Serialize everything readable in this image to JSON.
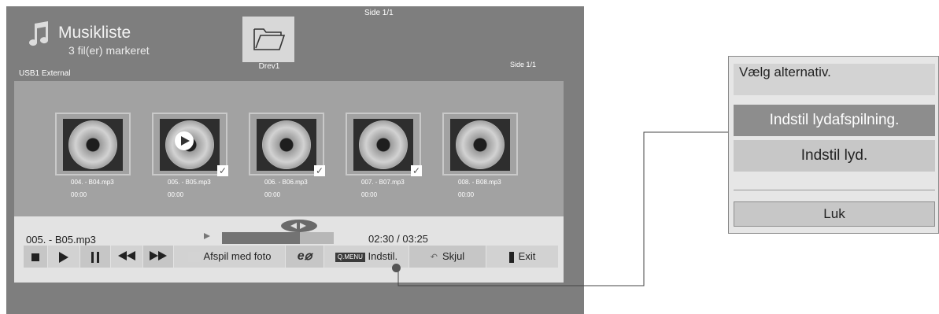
{
  "header": {
    "title": "Musikliste",
    "subtitle": "3 fil(er) markeret",
    "source": "USB1 External",
    "folder_label": "Drev1",
    "page_top": "Side 1/1",
    "page_right": "Side 1/1"
  },
  "files": [
    {
      "name": "004. - B04.mp3",
      "duration": "00:00",
      "checked": false,
      "playing": false
    },
    {
      "name": "005. - B05.mp3",
      "duration": "00:00",
      "checked": true,
      "playing": true
    },
    {
      "name": "006. - B06.mp3",
      "duration": "00:00",
      "checked": true,
      "playing": false
    },
    {
      "name": "007. - B07.mp3",
      "duration": "00:00",
      "checked": true,
      "playing": false
    },
    {
      "name": "008. - B08.mp3",
      "duration": "00:00",
      "checked": false,
      "playing": false
    }
  ],
  "player": {
    "track": "005. - B05.mp3",
    "time": "02:30 / 03:25",
    "progress": 0.7
  },
  "controls": {
    "photo_label": "Afspil med foto",
    "eco_label": "e",
    "qmenu_badge": "Q.MENU",
    "settings_label": "Indstil.",
    "hide_label": "Skjul",
    "exit_label": "Exit"
  },
  "popup": {
    "title": "Vælg alternativ.",
    "options": [
      "Indstil lydafspilning.",
      "Indstil lyd."
    ],
    "close_label": "Luk"
  },
  "colors": {
    "screen": "#7e7e7e",
    "grid": "#a2a2a2",
    "control_bar": "#e3e3e3",
    "highlight": "#8d8d8d"
  }
}
